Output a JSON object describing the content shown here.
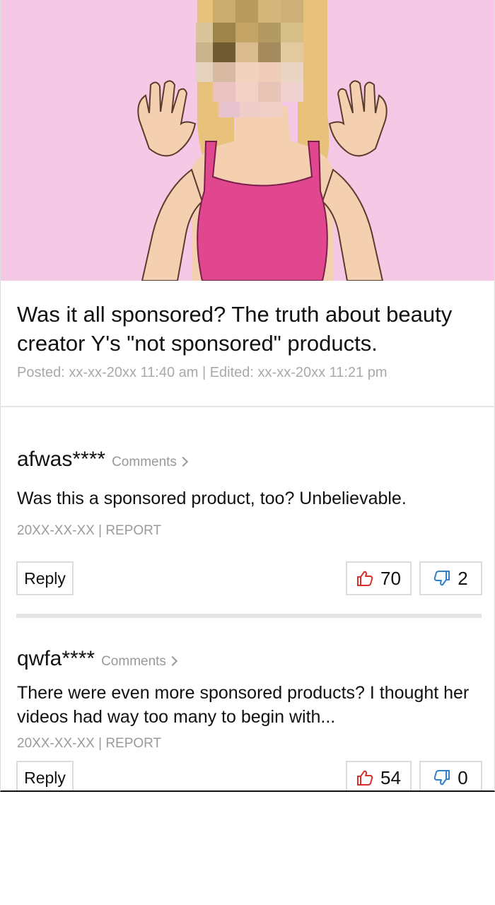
{
  "article": {
    "title": "Was it all sponsored? The truth about beauty creator Y's \"not sponsored\" products.",
    "meta": "Posted: xx-xx-20xx 11:40 am | Edited: xx-xx-20xx 11:21 pm"
  },
  "comments": [
    {
      "username": "afwas****",
      "comments_link": "Comments",
      "text": "Was this a sponsored product, too? Unbelievable.",
      "meta": "20XX-XX-XX | REPORT",
      "reply_label": "Reply",
      "likes": "70",
      "dislikes": "2"
    },
    {
      "username": "qwfa****",
      "comments_link": "Comments",
      "text": "There were even more sponsored products? I thought her videos had way too many to begin with...",
      "meta": "20XX-XX-XX | REPORT",
      "reply_label": "Reply",
      "likes": "54",
      "dislikes": "0"
    }
  ],
  "colors": {
    "hero_bg": "#f5c9e6",
    "like_icon": "#d9302a",
    "dislike_icon": "#2f7fd0"
  }
}
